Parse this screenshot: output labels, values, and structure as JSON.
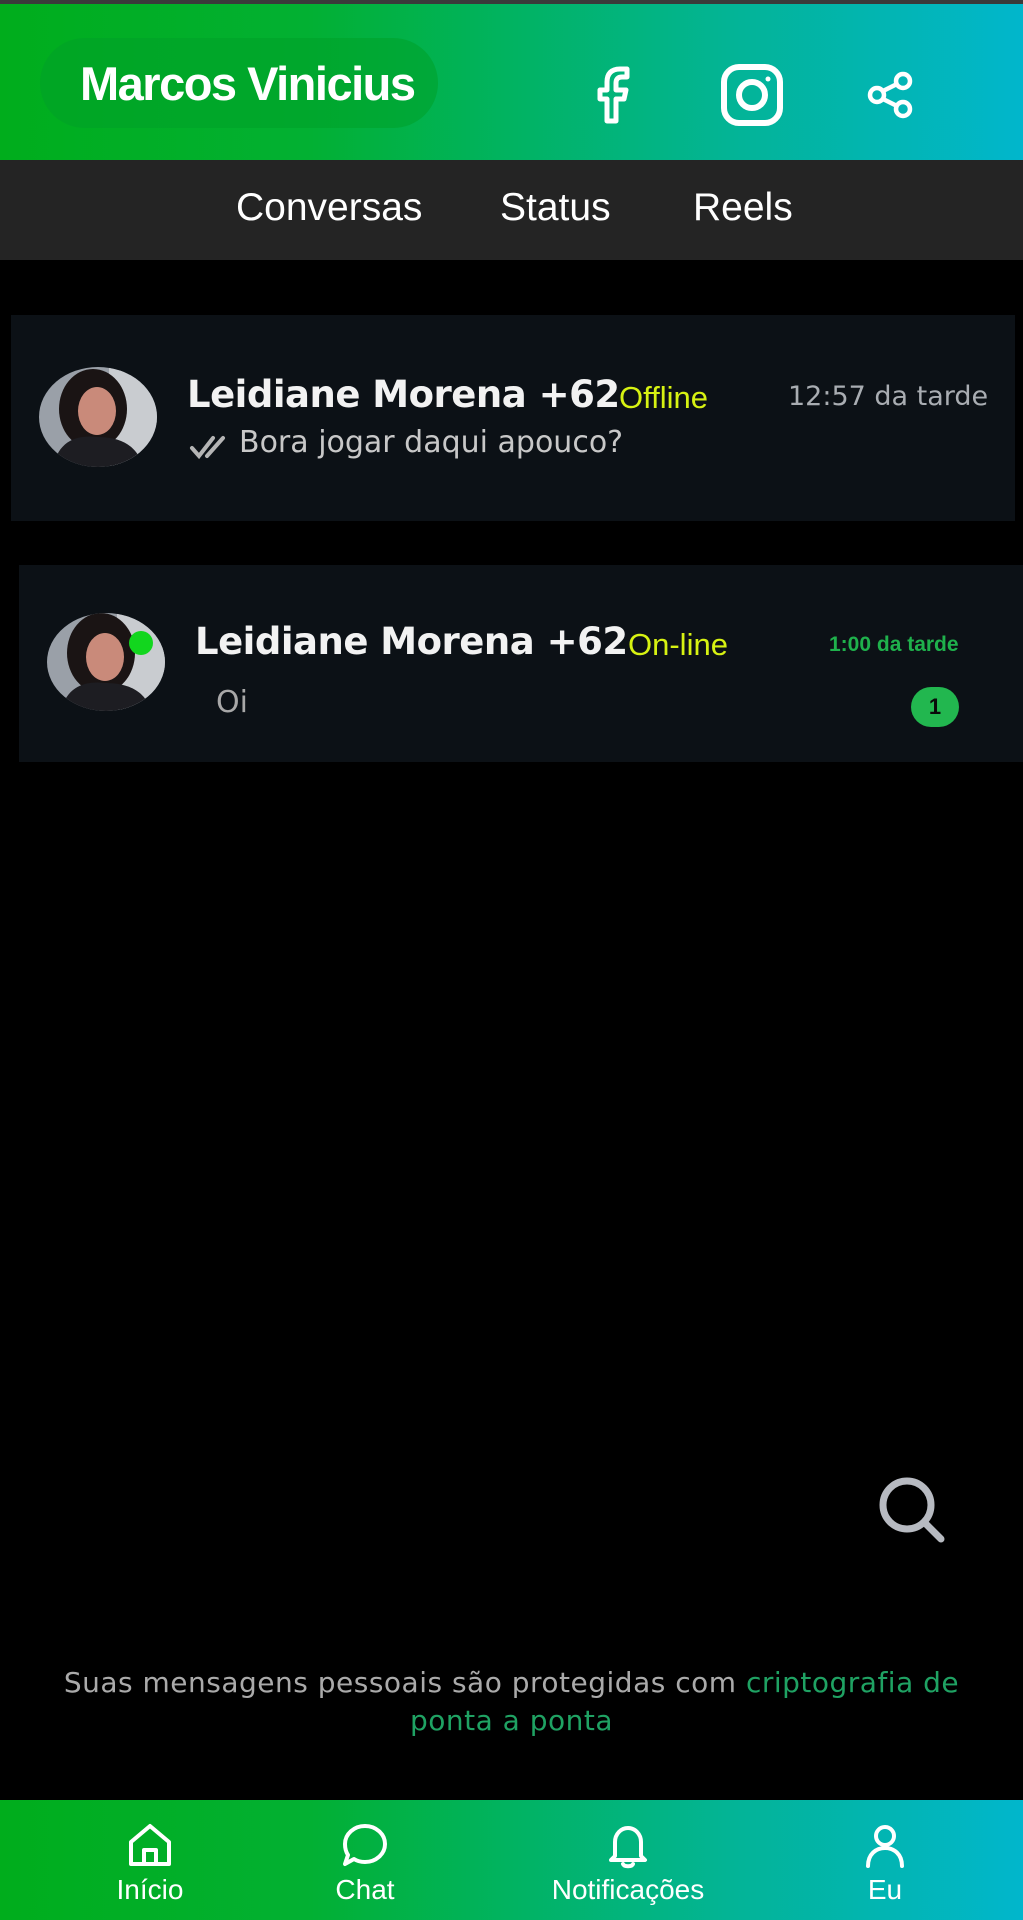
{
  "header": {
    "title": "Marcos Vinicius",
    "icons": [
      "facebook-icon",
      "instagram-icon",
      "share-icon"
    ]
  },
  "tabs": [
    {
      "label": "Conversas"
    },
    {
      "label": "Status"
    },
    {
      "label": "Reels"
    }
  ],
  "chats": [
    {
      "name": "Leidiane Morena +62",
      "status": "Offline",
      "time": "12:57 da tarde",
      "message": "Bora jogar daqui apouco?",
      "read_receipt_icon": "double-check-icon"
    },
    {
      "name": "Leidiane Morena +62",
      "status": "On-line",
      "time": "1:00 da tarde",
      "message": "Oi",
      "unread": "1"
    }
  ],
  "encryption": {
    "text": "Suas mensagens pessoais são protegidas com ",
    "link": "criptografia de ponta a ponta"
  },
  "bottom_nav": [
    {
      "label": "Início",
      "icon": "home-icon"
    },
    {
      "label": "Chat",
      "icon": "chat-bubble-icon"
    },
    {
      "label": "Notificações",
      "icon": "bell-icon"
    },
    {
      "label": "Eu",
      "icon": "user-icon"
    }
  ],
  "colors": {
    "brand_green": "#00ad1c",
    "brand_cyan": "#01b6cc",
    "status_yellow": "#d7f212",
    "online_green": "#12d61e",
    "unread_badge": "#22b74f",
    "link_green": "#1fa263"
  }
}
